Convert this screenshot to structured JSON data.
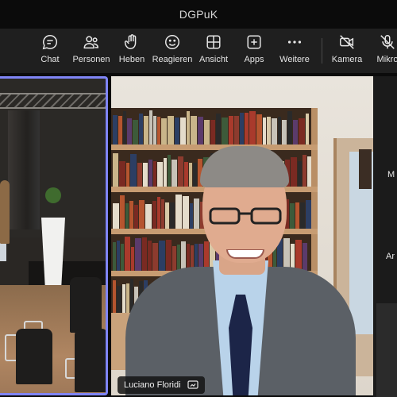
{
  "window": {
    "title": "DGPuK"
  },
  "toolbar": {
    "items": [
      {
        "label": "Chat",
        "icon": "chat-icon"
      },
      {
        "label": "Personen",
        "icon": "people-icon"
      },
      {
        "label": "Heben",
        "icon": "raise-hand-icon"
      },
      {
        "label": "Reagieren",
        "icon": "smiley-icon"
      },
      {
        "label": "Ansicht",
        "icon": "grid-view-icon"
      },
      {
        "label": "Apps",
        "icon": "apps-plus-icon"
      },
      {
        "label": "Weitere",
        "icon": "more-dots-icon"
      },
      {
        "label": "Kamera",
        "icon": "camera-off-icon"
      },
      {
        "label": "Mikro",
        "icon": "mic-off-icon"
      }
    ]
  },
  "video": {
    "main_participant_name": "Luciano Floridi",
    "active_speaker_border": "#7f85f5"
  },
  "right_panel": {
    "line1": "M",
    "line2": "Ar"
  }
}
